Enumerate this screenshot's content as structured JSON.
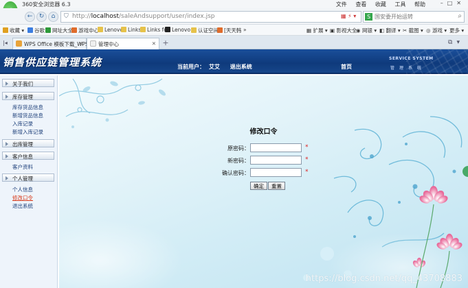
{
  "browser": {
    "app_title": "360安全浏览器 6.3",
    "menu": [
      "文件",
      "查看",
      "收藏",
      "工具",
      "帮助"
    ],
    "url_host": "localhost",
    "url_prefix": "http://",
    "url_path": "/saleAndsupport/user/index.jsp",
    "search_placeholder": "国安委开始运转",
    "bookmarks": [
      {
        "label": "收藏",
        "color": "#e0a020"
      },
      {
        "label": "谷歌",
        "color": "#3b7de0"
      },
      {
        "label": "网址大全",
        "color": "#2d9a3a"
      },
      {
        "label": "游戏中心",
        "color": "#e06c2b"
      },
      {
        "label": "Lenovo",
        "color": "#e6c24a"
      },
      {
        "label": "Links",
        "color": "#e6c24a"
      },
      {
        "label": "Links fo",
        "color": "#e6c24a"
      },
      {
        "label": "Lenovo",
        "color": "#222222"
      },
      {
        "label": "认证空间",
        "color": "#e6c24a"
      },
      {
        "label": "[天天韩",
        "color": "#e06c2b"
      }
    ],
    "bookmarks_more": "»",
    "toolbar_right": [
      "扩展",
      "影视大全",
      "网银",
      "翻译",
      "截图",
      "游戏",
      "更多"
    ],
    "tabs": [
      {
        "label": "WPS Office 模板下载_WPS C"
      },
      {
        "label": "管理中心"
      }
    ]
  },
  "header": {
    "system_title": "销售供应链管理系统",
    "current_user_label": "当前用户：",
    "current_user": "艾艾",
    "logout": "退出系统",
    "home": "首页",
    "service_system": "SERVICE SYSTEM",
    "service_sub": "管理系统"
  },
  "sidebar": {
    "sections": [
      {
        "label": "关于我们",
        "items": []
      },
      {
        "label": "库存管理",
        "items": [
          "库存货品信息",
          "新增货品信息",
          "入库记录",
          "新增入库记录"
        ]
      },
      {
        "label": "出库管理",
        "items": []
      },
      {
        "label": "客户信息",
        "items": [
          "客户资料"
        ]
      },
      {
        "label": "个人管理",
        "items": [
          "个人信息",
          "修改口令",
          "退出系统"
        ]
      }
    ]
  },
  "form": {
    "title": "修改口令",
    "fields": [
      {
        "label": "原密码：",
        "value": ""
      },
      {
        "label": "新密码：",
        "value": ""
      },
      {
        "label": "确认密码：",
        "value": ""
      }
    ],
    "required_mark": "*",
    "confirm_button": "确定",
    "reset_button": "重置"
  },
  "watermark": "https://blog.csdn.net/qq_43708883",
  "colors": {
    "banner": "#0f3a7c",
    "sidebar_bg": "#eef4fb",
    "link": "#1d3f7a",
    "active_link": "#d83a1a",
    "required": "#dd2222"
  }
}
